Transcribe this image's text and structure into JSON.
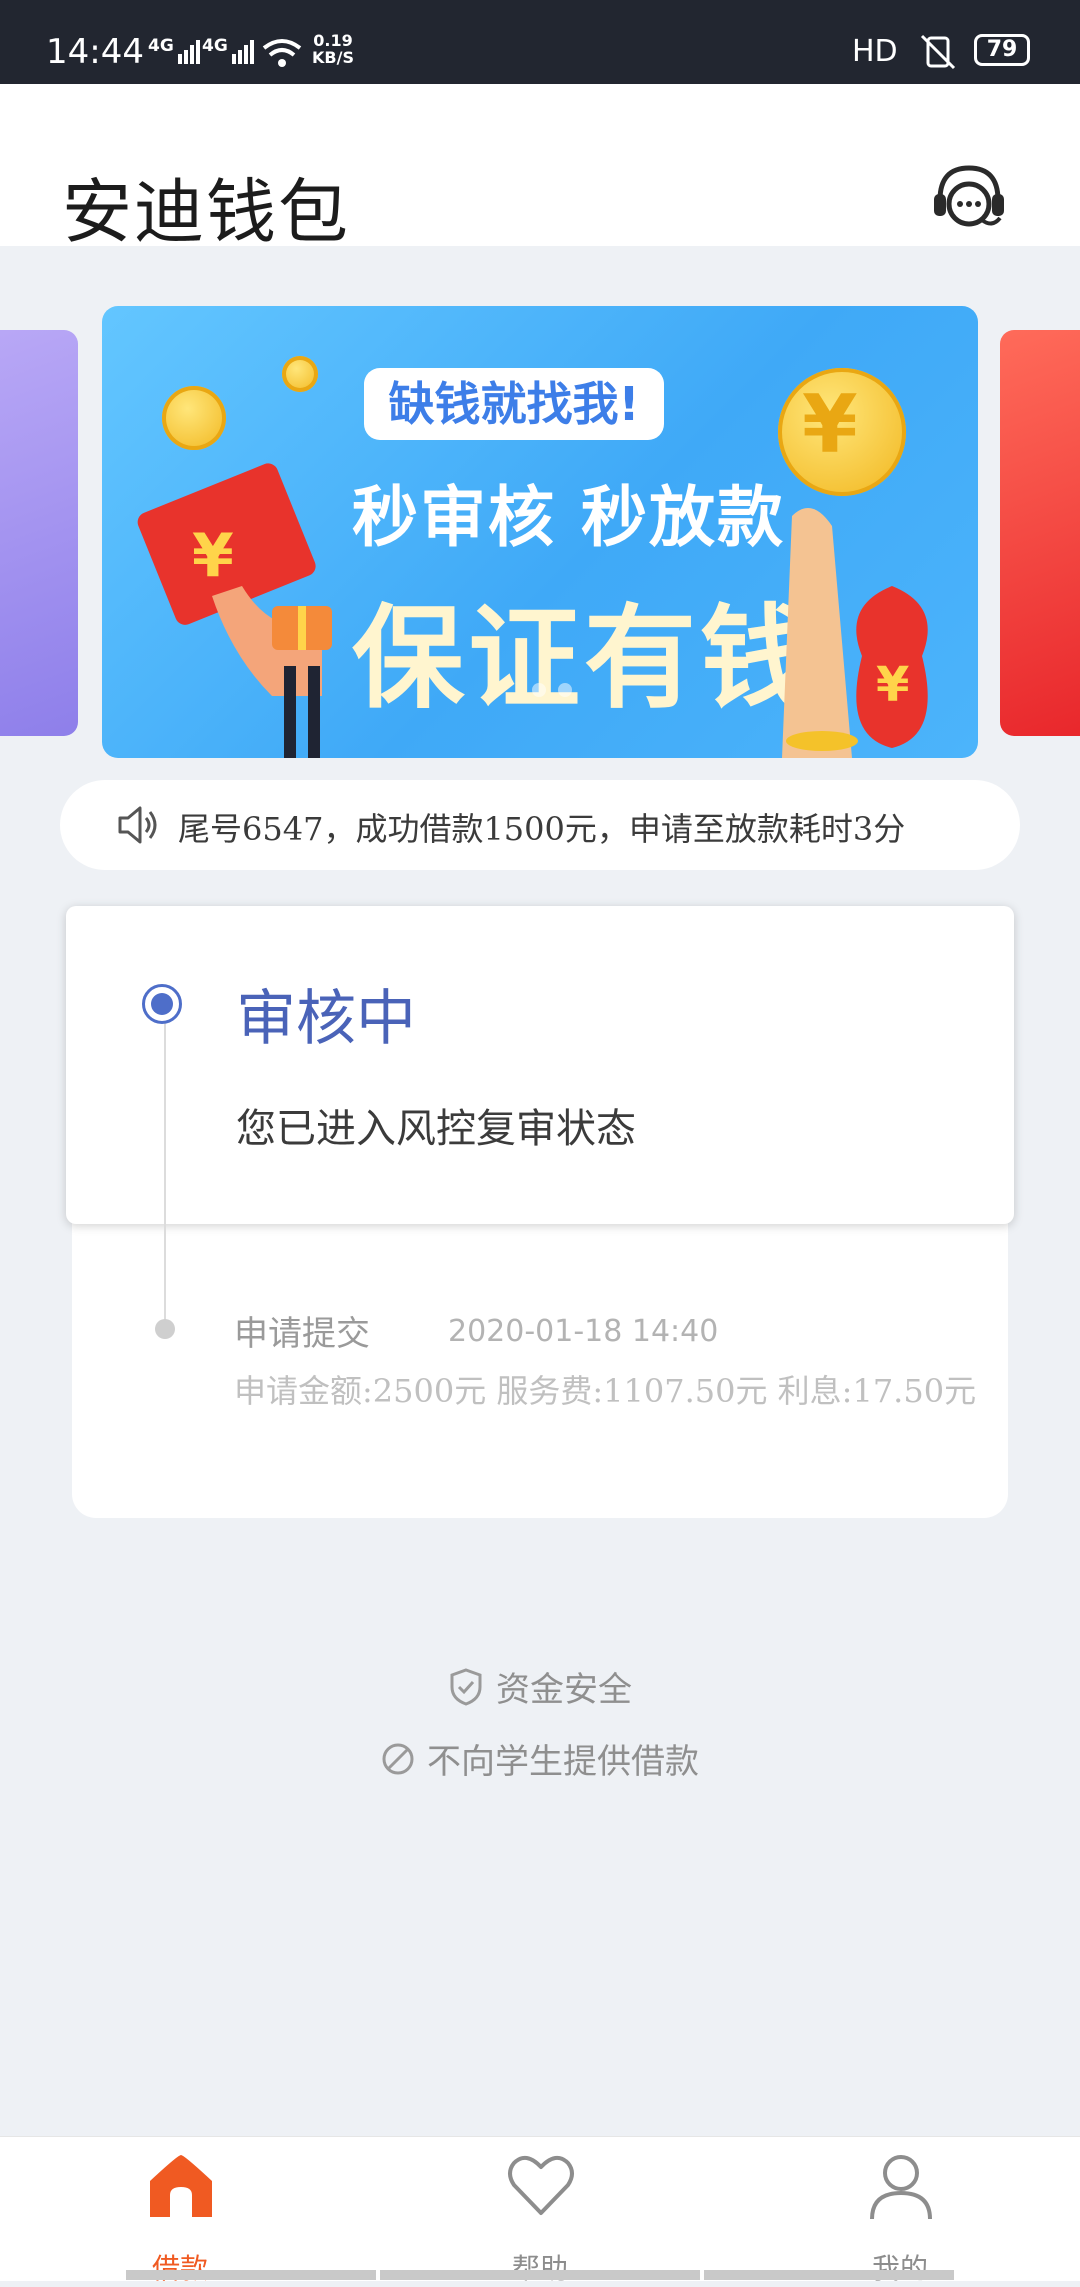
{
  "status_bar": {
    "time": "14:44",
    "network1": "4G",
    "network2": "4G",
    "speed_value": "0.19",
    "speed_unit": "KB/S",
    "hd": "HD",
    "battery": "79"
  },
  "header": {
    "title": "安迪钱包",
    "support_icon": "customer-service-icon"
  },
  "banner": {
    "pill": "缺钱就找我!",
    "line1": "秒审核 秒放款",
    "line2": "保证有钱",
    "symbol": "¥",
    "dots_count": 2
  },
  "notice": {
    "icon": "speaker-icon",
    "text": "尾号6547，成功借款1500元，申请至放款耗时3分"
  },
  "status": {
    "title": "审核中",
    "description": "您已进入风控复审状态"
  },
  "timeline": {
    "step": "申请提交",
    "time": "2020-01-18 14:40",
    "detail": "申请金额:2500元  服务费:1107.50元 利息:17.50元"
  },
  "footer": {
    "safe_icon": "shield-check-icon",
    "safe_text": "资金安全",
    "no_student_icon": "prohibited-icon",
    "no_student_text": "不向学生提供借款"
  },
  "tabs": [
    {
      "label": "借款",
      "icon": "home-icon",
      "active": true
    },
    {
      "label": "帮助",
      "icon": "heart-icon",
      "active": false
    },
    {
      "label": "我的",
      "icon": "user-icon",
      "active": false
    }
  ],
  "colors": {
    "accent": "#f05a22",
    "status_blue": "#4a63b8",
    "background": "#eef1f5"
  }
}
